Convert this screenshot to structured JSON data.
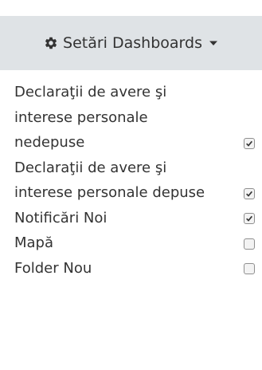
{
  "header": {
    "title": "Setări Dashboards",
    "icon": "gear-icon",
    "caret_icon": "caret-down-icon",
    "background": "#dfe3e6"
  },
  "menu": {
    "items": [
      {
        "label": "Declaraţii de avere şi interese personale nedepuse",
        "checked": true
      },
      {
        "label": "Declaraţii de avere şi interese personale depuse",
        "checked": true
      },
      {
        "label": "Notificări Noi",
        "checked": true
      },
      {
        "label": "Mapă",
        "checked": false
      },
      {
        "label": "Folder Nou",
        "checked": false
      }
    ]
  }
}
